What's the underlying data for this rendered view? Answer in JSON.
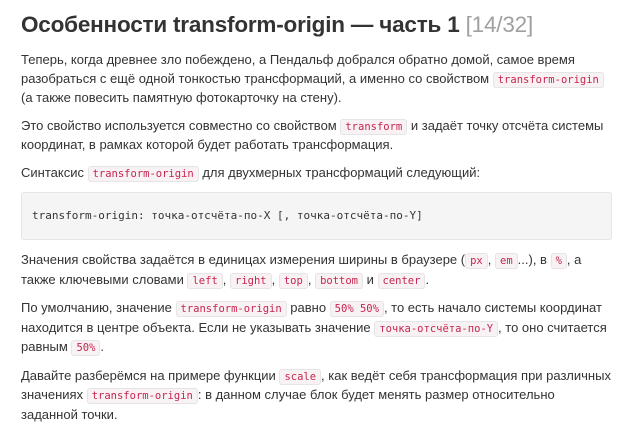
{
  "title": {
    "text": "Особенности transform-origin — часть 1",
    "counter": "[14/32]"
  },
  "p1": {
    "t1": "Теперь, когда древнее зло побеждено, а Пендальф добрался обратно домой, самое время разобраться с ещё одной тонкостью трансформаций, а именно со свойством ",
    "c1": "transform-origin",
    "t2": " (а также повесить памятную фотокарточку на стену)."
  },
  "p2": {
    "t1": "Это свойство используется совместно со свойством ",
    "c1": "transform",
    "t2": " и задаёт точку отсчёта системы координат, в рамках которой будет работать трансформация."
  },
  "p3": {
    "t1": "Синтаксис ",
    "c1": "transform-origin",
    "t2": " для двухмерных трансформаций следующий:"
  },
  "code_block": "transform-origin: точка-отсчёта-по-X [, точка-отсчёта-по-Y]",
  "p4": {
    "t1": "Значения свойства задаётся в единицах измерения ширины в браузере (",
    "c1": "px",
    "t2": ", ",
    "c2": "em",
    "t3": "...), в ",
    "c3": "%",
    "t4": ", а также ключевыми словами ",
    "c4": "left",
    "t5": ", ",
    "c5": "right",
    "t6": ", ",
    "c6": "top",
    "t7": ", ",
    "c7": "bottom",
    "t8": " и ",
    "c8": "center",
    "t9": "."
  },
  "p5": {
    "t1": "По умолчанию, значение ",
    "c1": "transform-origin",
    "t2": " равно ",
    "c2": "50% 50%",
    "t3": ", то есть начало системы координат находится в центре объекта. Если не указывать значение ",
    "c3": "точка-отсчёта-по-Y",
    "t4": ", то оно считается равным ",
    "c4": "50%",
    "t5": "."
  },
  "p6": {
    "t1": "Давайте разберёмся на примере функции ",
    "c1": "scale",
    "t2": ", как ведёт себя трансформация при различных значениях ",
    "c2": "transform-origin",
    "t3": ": в данном случае блок будет менять размер относительно заданной точки."
  }
}
